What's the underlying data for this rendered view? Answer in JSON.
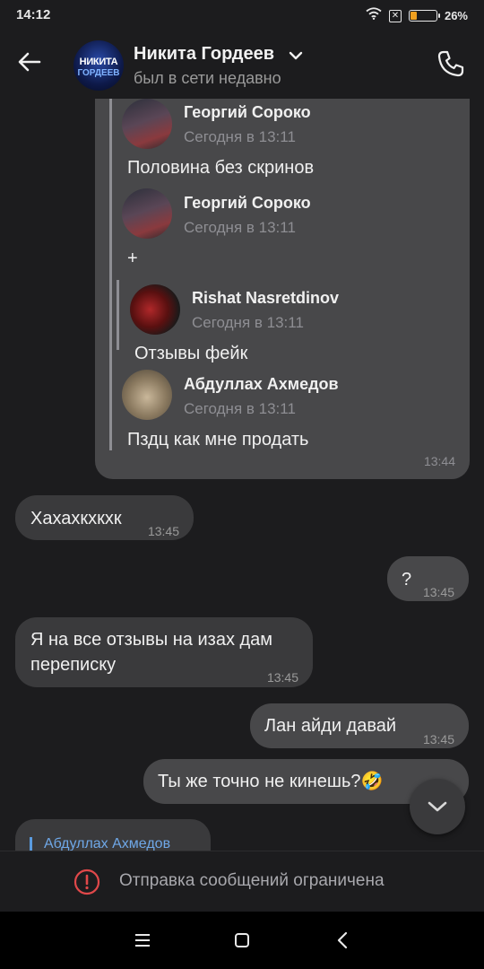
{
  "status_bar": {
    "time": "14:12",
    "battery_percent": "26%",
    "battery_level": 0.26,
    "battery_color": "#f0a020"
  },
  "header": {
    "back_icon": "arrow-left-icon",
    "avatar_line1": "НИКИТА",
    "avatar_line2": "ГОРДЕЕВ",
    "contact_name": "Никита Гордеев",
    "contact_status": "был в сети недавно",
    "call_icon": "phone-icon"
  },
  "forwarded_bubble": {
    "items": [
      {
        "author": "Георгий Сороко",
        "date": "Сегодня в 13:11",
        "text": "Половина без скринов"
      },
      {
        "author": "Георгий Сороко",
        "date": "Сегодня в 13:11",
        "text": "+"
      },
      {
        "author": "Rishat Nasretdinov",
        "date": "Сегодня в 13:11",
        "text": "Отзывы фейк"
      },
      {
        "author": "Абдуллах Ахмедов",
        "date": "Сегодня в 13:11",
        "text": "Пздц как мне продать"
      }
    ],
    "time": "13:44"
  },
  "messages": [
    {
      "dir": "in",
      "text": "Хахахкхкхк",
      "time": "13:45"
    },
    {
      "dir": "out",
      "text": "?",
      "time": "13:45"
    },
    {
      "dir": "in",
      "text_line1": "Я на все отзывы на изах дам",
      "text_line2": "переписку",
      "time": "13:45"
    },
    {
      "dir": "out",
      "text": "Лан айди давай",
      "time": "13:45"
    },
    {
      "dir": "out",
      "text": "Ты же точно не кинешь?🤣"
    }
  ],
  "reply_preview": {
    "author": "Абдуллах Ахмедов"
  },
  "composer": {
    "restricted_text": "Отправка сообщений ограничена",
    "accent": "#e0484a"
  },
  "colors": {
    "background": "#1c1c1e",
    "incoming_bubble": "#3a3a3c",
    "outgoing_bubble": "#48484a",
    "link": "#6fa8e8"
  }
}
